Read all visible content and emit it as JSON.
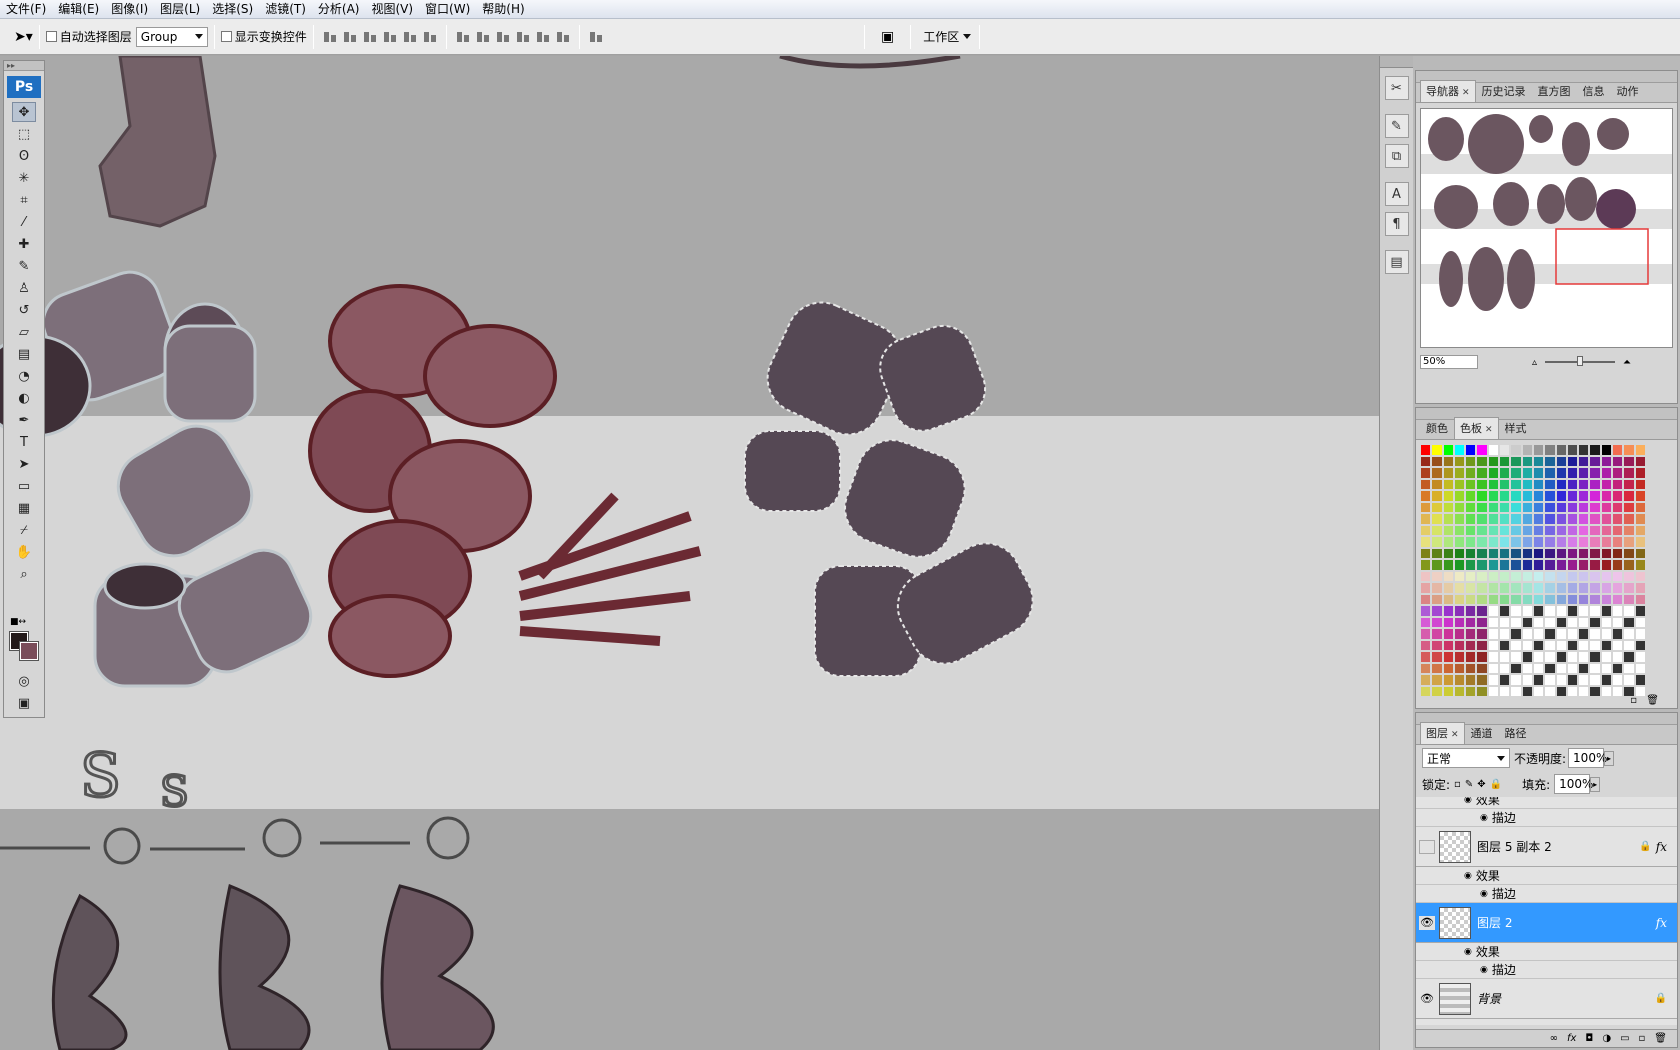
{
  "menu": [
    "文件(F)",
    "编辑(E)",
    "图像(I)",
    "图层(L)",
    "选择(S)",
    "滤镜(T)",
    "分析(A)",
    "视图(V)",
    "窗口(W)",
    "帮助(H)"
  ],
  "options": {
    "auto_select_label": "自动选择图层",
    "auto_select_value": "Group",
    "show_transform_label": "显示变换控件",
    "workspace_label": "工作区"
  },
  "toolbox": {
    "logo": "Ps",
    "tools": [
      "move-icon",
      "marquee-icon",
      "lasso-icon",
      "magic-wand-icon",
      "crop-icon",
      "slice-icon",
      "healing-brush-icon",
      "brush-icon",
      "clone-stamp-icon",
      "history-brush-icon",
      "eraser-icon",
      "gradient-icon",
      "blur-icon",
      "dodge-icon",
      "pen-icon",
      "type-icon",
      "path-selection-icon",
      "shape-icon",
      "notes-icon",
      "eyedropper-icon",
      "hand-icon",
      "zoom-icon"
    ],
    "foreground_color": "#231a1a",
    "background_color": "#7a4d5a"
  },
  "navigator": {
    "tabs": [
      "导航器",
      "历史记录",
      "直方图",
      "信息",
      "动作"
    ],
    "zoom": "50%"
  },
  "swatches": {
    "tabs": [
      "颜色",
      "色板",
      "样式"
    ]
  },
  "layers": {
    "tabs": [
      "图层",
      "通道",
      "路径"
    ],
    "blend_mode": "正常",
    "opacity_label": "不透明度:",
    "opacity_value": "100%",
    "lock_label": "锁定:",
    "fill_label": "填充:",
    "fill_value": "100%",
    "effects_label": "效果",
    "stroke_label": "描边",
    "items": [
      {
        "name": "图层 5 副本 2",
        "visible": false,
        "fx": "fx",
        "selected": false
      },
      {
        "name": "图层 2",
        "visible": true,
        "fx": "fx",
        "selected": true
      },
      {
        "name": "背景",
        "visible": true,
        "fx": "",
        "selected": false
      }
    ]
  },
  "colors": {
    "selection": "#3399ff",
    "ps_blue": "#1f6fc1",
    "canvas_gray": "#a9a9a9"
  }
}
